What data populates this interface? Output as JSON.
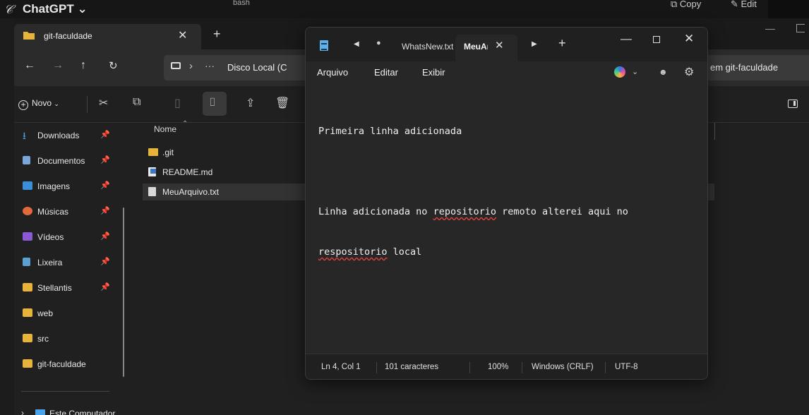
{
  "top": {
    "app_title": "ChatGPT ⌄",
    "bash_label": "bash",
    "copy_label": "⧉ Copy",
    "edit_label": "✎ Edit"
  },
  "explorer": {
    "tab_label": "git-faculdade",
    "address": {
      "ellipsis": "···",
      "crumb": "Disco Local (C"
    },
    "search_text": "em git-faculdade",
    "new_label": "Novo",
    "sidebar": {
      "items": [
        {
          "label": "Downloads",
          "icon": "download-icon",
          "pinned": true
        },
        {
          "label": "Documentos",
          "icon": "document-icon",
          "pinned": true
        },
        {
          "label": "Imagens",
          "icon": "image-icon",
          "pinned": true
        },
        {
          "label": "Músicas",
          "icon": "music-icon",
          "pinned": true
        },
        {
          "label": "Vídeos",
          "icon": "video-icon",
          "pinned": true
        },
        {
          "label": "Lixeira",
          "icon": "recycle-bin-icon",
          "pinned": true
        },
        {
          "label": "Stellantis",
          "icon": "folder-icon",
          "pinned": true
        },
        {
          "label": "web",
          "icon": "folder-icon",
          "pinned": false
        },
        {
          "label": "src",
          "icon": "folder-icon",
          "pinned": false
        },
        {
          "label": "git-faculdade",
          "icon": "folder-icon",
          "pinned": false
        }
      ],
      "this_pc": "Este Computador"
    },
    "list": {
      "column_name": "Nome",
      "files": [
        {
          "name": ".git",
          "type": "folder"
        },
        {
          "name": "README.md",
          "type": "markdown"
        },
        {
          "name": "MeuArquivo.txt",
          "type": "text",
          "selected": true
        }
      ]
    }
  },
  "notepad": {
    "tab_inactive": "WhatsNew.txt",
    "tab_active": "MeuArquivo.txt",
    "menu": [
      "Arquivo",
      "Editar",
      "Exibir"
    ],
    "lines": [
      {
        "text": "Primeira linha adicionada"
      },
      {
        "text": ""
      },
      {
        "pre": "Linha adicionada no ",
        "spell": "repositorio",
        "post": " remoto alterei aqui no"
      },
      {
        "pre": "",
        "spell": "respositorio",
        "post": " local"
      }
    ],
    "status": {
      "position": "Ln 4, Col 1",
      "chars": "101 caracteres",
      "zoom": "100%",
      "line_ending": "Windows (CRLF)",
      "encoding": "UTF-8"
    }
  },
  "colors": {
    "folder": "#e8b33a",
    "spell_underline": "#e04040",
    "notepad_bg": "#272727"
  }
}
